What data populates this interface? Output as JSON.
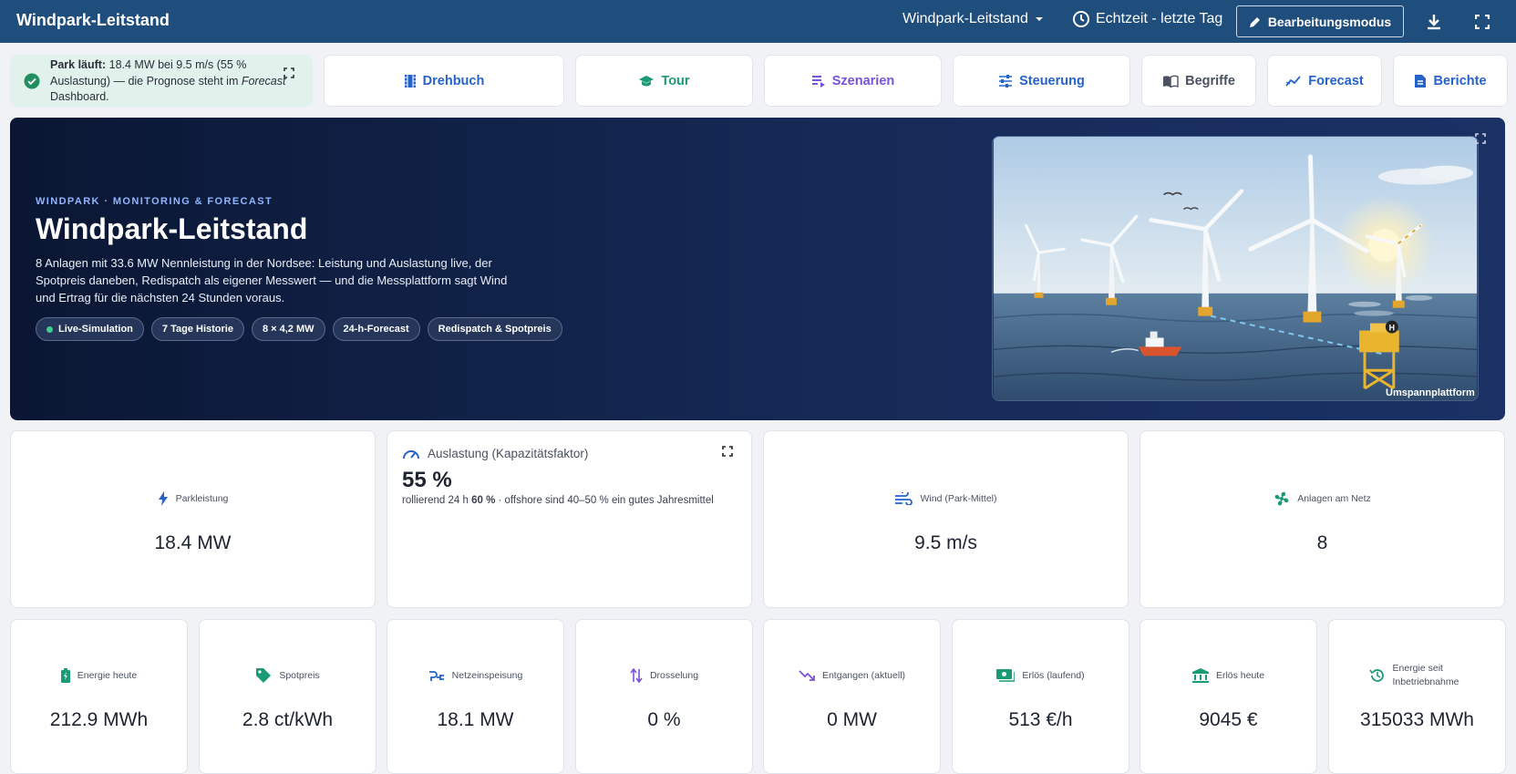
{
  "topbar": {
    "app_title": "Windpark-Leitstand",
    "dashboard_select": "Windpark-Leitstand",
    "time_range": "Echtzeit - letzte Tag",
    "edit_button": "Bearbeitungsmodus",
    "icons": [
      "chevron-down-icon",
      "clock-icon",
      "pencil-icon",
      "download-icon",
      "fullscreen-icon"
    ]
  },
  "notice": {
    "bold": "Park läuft:",
    "text": " 18.4 MW bei 9.5 m/s (55 % Auslastung) — die Prognose steht im ",
    "italic": "Forecast",
    "text2": " Dashboard."
  },
  "nav": [
    {
      "label": "Drehbuch",
      "icon": "film-icon",
      "color": "#2563c9"
    },
    {
      "label": "Tour",
      "icon": "graduation-cap-icon",
      "color": "#1a9a75"
    },
    {
      "label": "Szenarien",
      "icon": "list-play-icon",
      "color": "#7a52d8"
    },
    {
      "label": "Steuerung",
      "icon": "sliders-icon",
      "color": "#2563c9"
    },
    {
      "label": "Begriffe",
      "icon": "book-icon",
      "color": "#4a5160"
    },
    {
      "label": "Forecast",
      "icon": "trend-icon",
      "color": "#2563c9"
    },
    {
      "label": "Berichte",
      "icon": "report-icon",
      "color": "#2563c9"
    }
  ],
  "hero": {
    "kicker": "WINDPARK · MONITORING & FORECAST",
    "title": "Windpark-Leitstand",
    "description": "8 Anlagen mit 33.6 MW Nennleistung in der Nordsee: Leistung und Auslastung live, der Spotpreis daneben, Redispatch als eigener Messwert — und die Messplattform sagt Wind und Ertrag für die nächsten 24 Stunden voraus.",
    "chips": [
      "Live-Simulation",
      "7 Tage Historie",
      "8 × 4,2 MW",
      "24-h-Forecast",
      "Redispatch & Spotpreis"
    ],
    "scene_label": "Umspannplattform",
    "platform_badge": "H"
  },
  "kpis_top": {
    "park_power": {
      "label": "Parkleistung",
      "value": "18.4 MW",
      "icon": "bolt-icon"
    },
    "utilization": {
      "label": "Auslastung (Kapazitätsfaktor)",
      "value": "55 %",
      "sub_prefix": "rollierend 24 h ",
      "sub_bold": "60 %",
      "sub_suffix": " · offshore sind 40–50 % ein gutes Jahresmittel",
      "icon": "gauge-icon"
    },
    "wind": {
      "label": "Wind (Park-Mittel)",
      "value": "9.5 m/s",
      "icon": "wind-icon"
    },
    "turbines": {
      "label": "Anlagen am Netz",
      "value": "8",
      "icon": "fan-icon"
    }
  },
  "kpis_bottom": [
    {
      "label": "Energie heute",
      "value": "212.9 MWh",
      "icon": "battery-icon",
      "color": "#1a9a75"
    },
    {
      "label": "Spotpreis",
      "value": "2.8 ct/kWh",
      "icon": "tag-icon",
      "color": "#1a9a75"
    },
    {
      "label": "Netzeinspeisung",
      "value": "18.1 MW",
      "icon": "plug-icon",
      "color": "#2563c9"
    },
    {
      "label": "Drosselung",
      "value": "0 %",
      "icon": "arrows-updown-icon",
      "color": "#7a52d8"
    },
    {
      "label": "Entgangen (aktuell)",
      "value": "0 MW",
      "icon": "trend-down-icon",
      "color": "#7a52d8"
    },
    {
      "label": "Erlös (laufend)",
      "value": "513 €/h",
      "icon": "cash-icon",
      "color": "#1a9a75"
    },
    {
      "label": "Erlös heute",
      "value": "9045 €",
      "icon": "bank-icon",
      "color": "#1a9a75"
    },
    {
      "label": "Energie seit Inbetriebnahme",
      "value": "315033 MWh",
      "icon": "history-icon",
      "color": "#1a9a75"
    }
  ]
}
